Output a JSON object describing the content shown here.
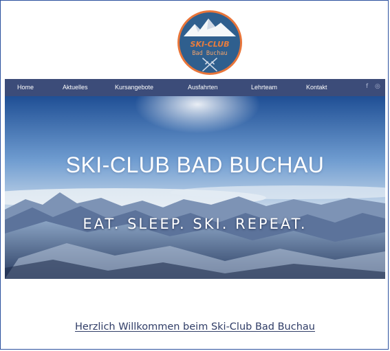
{
  "logo": {
    "line1": "SKI-CLUB",
    "line2": "Bad Buchau"
  },
  "nav": {
    "items": [
      "Home",
      "Aktuelles",
      "Kursangebote",
      "Ausfahrten",
      "Lehrteam",
      "Kontakt"
    ],
    "social": [
      "f",
      "◎"
    ]
  },
  "hero": {
    "title": "SKI-CLUB BAD BUCHAU",
    "subtitle": "EAT. SLEEP. SKI. REPEAT."
  },
  "main": {
    "welcome": "Herzlich Willkommen beim Ski-Club Bad Buchau"
  },
  "colors": {
    "nav_bg": "#3c4c79",
    "logo_ring": "#e8753a",
    "logo_bg": "#2f5f8e",
    "text": "#2f3c66"
  }
}
